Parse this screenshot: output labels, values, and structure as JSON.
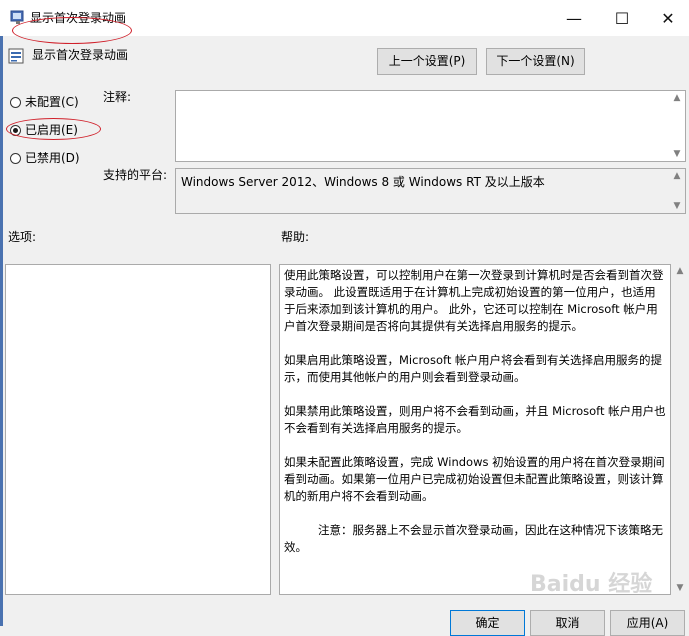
{
  "window": {
    "title": "显示首次登录动画",
    "controls": {
      "minimize": "—",
      "maximize": "☐",
      "close": "✕"
    }
  },
  "policy": {
    "name": "显示首次登录动画",
    "prev_setting": "上一个设置(P)",
    "next_setting": "下一个设置(N)"
  },
  "radios": {
    "not_configured": "未配置(C)",
    "enabled": "已启用(E)",
    "disabled": "已禁用(D)",
    "selected": "enabled"
  },
  "labels": {
    "comment": "注释:",
    "supported_on": "支持的平台:",
    "options": "选项:",
    "help": "帮助:"
  },
  "supported_platform": "Windows Server 2012、Windows 8 或 Windows RT 及以上版本",
  "help_paragraphs": [
    "使用此策略设置，可以控制用户在第一次登录到计算机时是否会看到首次登录动画。 此设置既适用于在计算机上完成初始设置的第一位用户，也适用于后来添加到该计算机的用户。 此外，它还可以控制在 Microsoft 帐户用户首次登录期间是否将向其提供有关选择启用服务的提示。",
    "如果启用此策略设置，Microsoft 帐户用户将会看到有关选择启用服务的提示，而使用其他帐户的用户则会看到登录动画。",
    "如果禁用此策略设置，则用户将不会看到动画，并且 Microsoft 帐户用户也不会看到有关选择启用服务的提示。",
    "如果未配置此策略设置，完成 Windows 初始设置的用户将在首次登录期间看到动画。如果第一位用户已完成初始设置但未配置此策略设置，则该计算机的新用户将不会看到动画。",
    "注意：服务器上不会显示首次登录动画，因此在这种情况下该策略无效。"
  ],
  "buttons": {
    "ok": "确定",
    "cancel": "取消",
    "apply": "应用(A)"
  },
  "watermark": "Baidu 经验",
  "colors": {
    "annotation": "#d0202a",
    "accent": "#0078d7"
  }
}
